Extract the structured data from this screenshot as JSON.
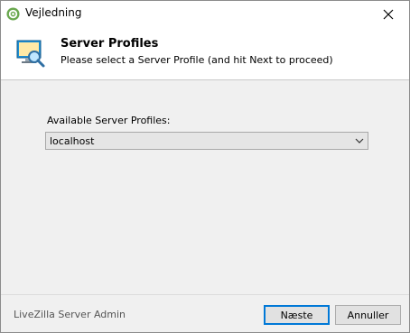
{
  "window": {
    "title": "Vejledning"
  },
  "header": {
    "title": "Server Profiles",
    "subtitle": "Please select a Server Profile (and hit Next to proceed)"
  },
  "form": {
    "label": "Available Server Profiles:",
    "selected": "localhost"
  },
  "footer": {
    "brand": "LiveZilla Server Admin",
    "next_label": "Næste",
    "cancel_label": "Annuller"
  },
  "colors": {
    "accent": "#0078d7"
  }
}
